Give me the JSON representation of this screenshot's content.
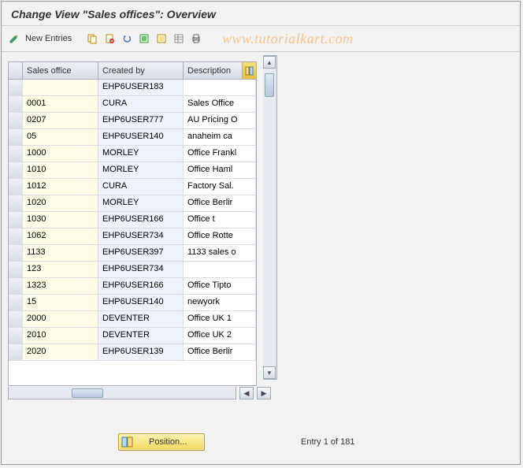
{
  "title": "Change View \"Sales offices\": Overview",
  "watermark": "www.tutorialkart.com",
  "toolbar": {
    "new_entries_label": "New Entries"
  },
  "table": {
    "headers": {
      "sales_office": "Sales office",
      "created_by": "Created by",
      "description": "Description"
    },
    "rows": [
      {
        "so": "",
        "cb": "EHP6USER183",
        "de": ""
      },
      {
        "so": "0001",
        "cb": "CURA",
        "de": "Sales Office"
      },
      {
        "so": "0207",
        "cb": "EHP6USER777",
        "de": "AU Pricing O"
      },
      {
        "so": "05",
        "cb": "EHP6USER140",
        "de": "anaheim ca"
      },
      {
        "so": "1000",
        "cb": "MORLEY",
        "de": "Office Frankl"
      },
      {
        "so": "1010",
        "cb": "MORLEY",
        "de": "Office Haml"
      },
      {
        "so": "1012",
        "cb": "CURA",
        "de": "Factory Sal."
      },
      {
        "so": "1020",
        "cb": "MORLEY",
        "de": "Office Berlir"
      },
      {
        "so": "1030",
        "cb": "EHP6USER166",
        "de": "Office t"
      },
      {
        "so": "1062",
        "cb": "EHP6USER734",
        "de": "Office Rotte"
      },
      {
        "so": "1133",
        "cb": "EHP6USER397",
        "de": "1133 sales o"
      },
      {
        "so": "123",
        "cb": "EHP6USER734",
        "de": ""
      },
      {
        "so": "1323",
        "cb": "EHP6USER166",
        "de": "Office Tipto"
      },
      {
        "so": "15",
        "cb": "EHP6USER140",
        "de": "newyork"
      },
      {
        "so": "2000",
        "cb": "DEVENTER",
        "de": "Office UK 1"
      },
      {
        "so": "2010",
        "cb": "DEVENTER",
        "de": "Office UK 2"
      },
      {
        "so": "2020",
        "cb": "EHP6USER139",
        "de": "Office Berlir"
      }
    ]
  },
  "footer": {
    "position_label": "Position...",
    "entry_label": "Entry 1 of 181"
  }
}
